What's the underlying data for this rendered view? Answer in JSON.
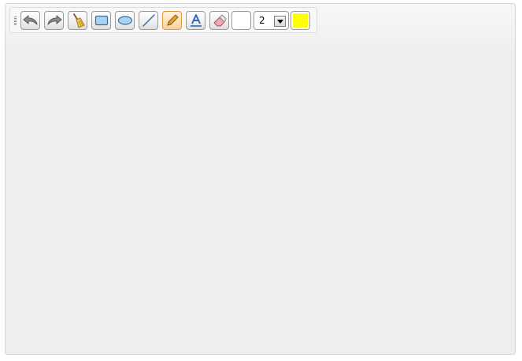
{
  "toolbar": {
    "tools": [
      {
        "name": "undo",
        "icon": "undo-icon"
      },
      {
        "name": "redo",
        "icon": "redo-icon"
      },
      {
        "name": "clear",
        "icon": "broom-icon"
      },
      {
        "name": "rectangle",
        "icon": "rectangle-icon"
      },
      {
        "name": "ellipse",
        "icon": "ellipse-icon"
      },
      {
        "name": "line",
        "icon": "line-icon"
      },
      {
        "name": "pencil",
        "icon": "pencil-icon",
        "selected": true
      },
      {
        "name": "text",
        "icon": "text-icon"
      },
      {
        "name": "eraser",
        "icon": "eraser-icon"
      }
    ],
    "fill_color": "#ffffff",
    "line_width": "2",
    "stroke_color": "#ffff00"
  },
  "canvas": {
    "background": "#eeeeee"
  }
}
